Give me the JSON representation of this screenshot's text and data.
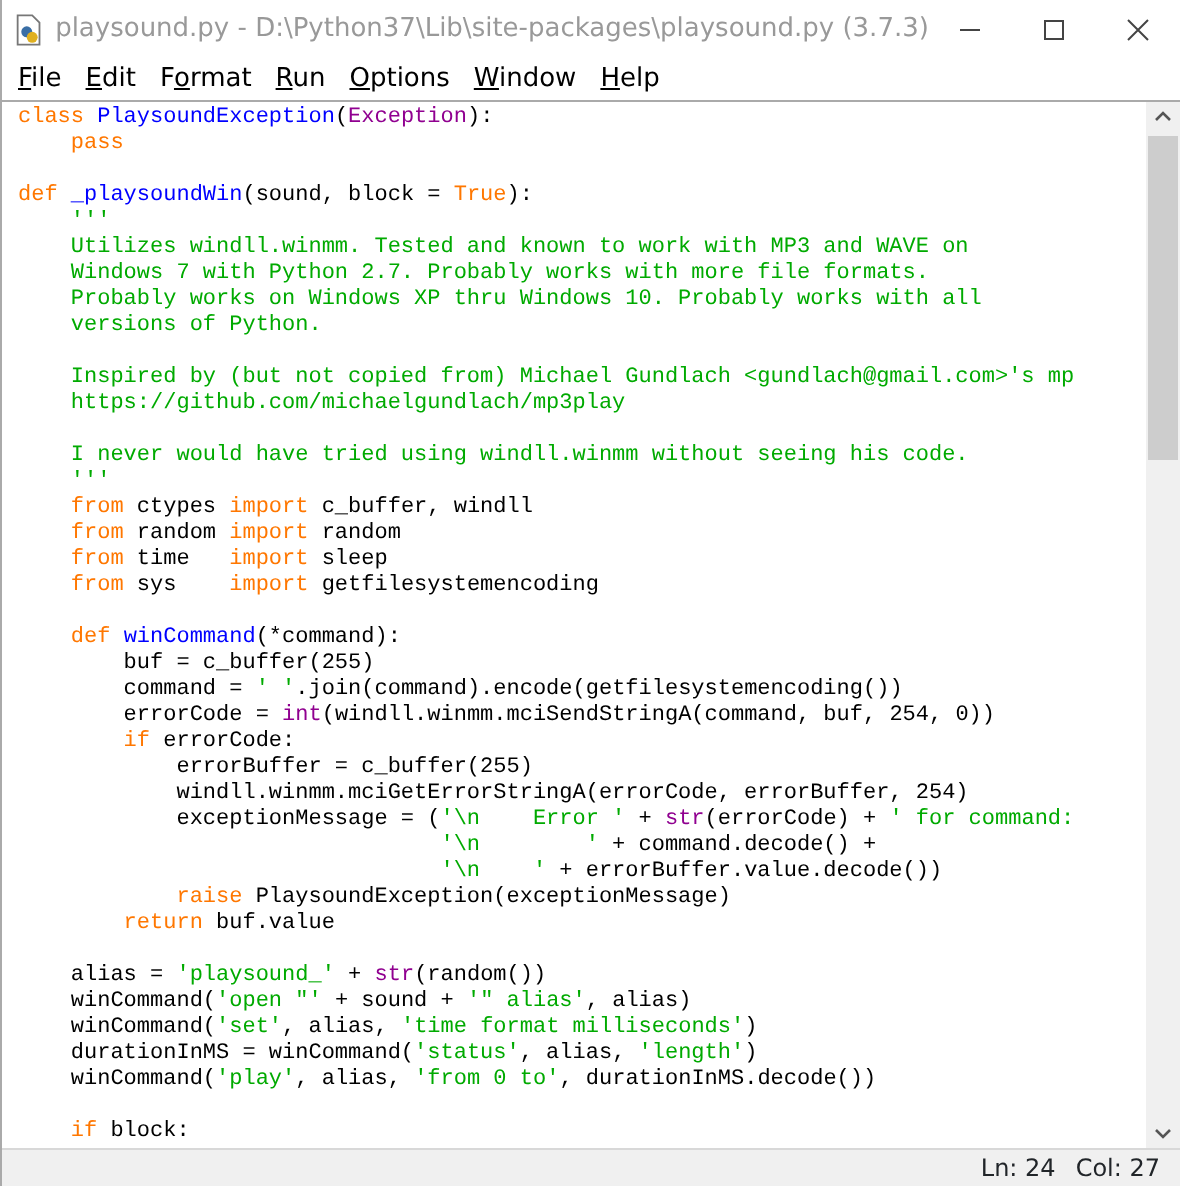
{
  "window": {
    "title": "playsound.py - D:\\Python37\\Lib\\site-packages\\playsound.py (3.7.3)"
  },
  "menu": [
    {
      "access_key": "F",
      "rest": "ile"
    },
    {
      "access_key": "E",
      "rest": "dit"
    },
    {
      "lead": "F",
      "access_key": "o",
      "rest": "rmat"
    },
    {
      "access_key": "R",
      "rest": "un"
    },
    {
      "access_key": "O",
      "rest": "ptions"
    },
    {
      "access_key": "W",
      "rest": "indow"
    },
    {
      "access_key": "H",
      "rest": "elp"
    }
  ],
  "editor": {
    "lines": [
      {
        "kind": "code",
        "tokens": [
          {
            "kind": "keyword",
            "text": "class "
          },
          {
            "kind": "definition",
            "text": "PlaysoundException"
          },
          {
            "kind": "plain",
            "text": "("
          },
          {
            "kind": "builtin",
            "text": "Exception"
          },
          {
            "kind": "plain",
            "text": "):"
          }
        ]
      },
      {
        "kind": "code",
        "tokens": [
          {
            "kind": "keyword",
            "text": "    pass"
          }
        ]
      },
      {
        "kind": "blank"
      },
      {
        "kind": "code",
        "tokens": [
          {
            "kind": "keyword",
            "text": "def "
          },
          {
            "kind": "definition",
            "text": "_playsoundWin"
          },
          {
            "kind": "plain",
            "text": "(sound, block = "
          },
          {
            "kind": "keyword",
            "text": "True"
          },
          {
            "kind": "plain",
            "text": "):"
          }
        ]
      },
      {
        "kind": "code",
        "tokens": [
          {
            "kind": "string",
            "text": "    '''"
          }
        ]
      },
      {
        "kind": "code",
        "tokens": [
          {
            "kind": "string",
            "text": "    Utilizes windll.winmm. Tested and known to work with MP3 and WAVE on"
          }
        ]
      },
      {
        "kind": "code",
        "tokens": [
          {
            "kind": "string",
            "text": "    Windows 7 with Python 2.7. Probably works with more file formats."
          }
        ]
      },
      {
        "kind": "code",
        "tokens": [
          {
            "kind": "string",
            "text": "    Probably works on Windows XP thru Windows 10. Probably works with all"
          }
        ]
      },
      {
        "kind": "code",
        "tokens": [
          {
            "kind": "string",
            "text": "    versions of Python."
          }
        ]
      },
      {
        "kind": "blank"
      },
      {
        "kind": "code",
        "tokens": [
          {
            "kind": "string",
            "text": "    Inspired by (but not copied from) Michael Gundlach <gundlach@gmail.com>'s mp"
          }
        ]
      },
      {
        "kind": "code",
        "tokens": [
          {
            "kind": "string",
            "text": "    https://github.com/michaelgundlach/mp3play"
          }
        ]
      },
      {
        "kind": "blank"
      },
      {
        "kind": "code",
        "tokens": [
          {
            "kind": "string",
            "text": "    I never would have tried using windll.winmm without seeing his code."
          }
        ]
      },
      {
        "kind": "code",
        "tokens": [
          {
            "kind": "string",
            "text": "    '''"
          }
        ]
      },
      {
        "kind": "code",
        "tokens": [
          {
            "kind": "keyword",
            "text": "    from"
          },
          {
            "kind": "plain",
            "text": " ctypes "
          },
          {
            "kind": "keyword",
            "text": "import"
          },
          {
            "kind": "plain",
            "text": " c_buffer, windll"
          }
        ]
      },
      {
        "kind": "code",
        "tokens": [
          {
            "kind": "keyword",
            "text": "    from"
          },
          {
            "kind": "plain",
            "text": " random "
          },
          {
            "kind": "keyword",
            "text": "import"
          },
          {
            "kind": "plain",
            "text": " random"
          }
        ]
      },
      {
        "kind": "code",
        "tokens": [
          {
            "kind": "keyword",
            "text": "    from"
          },
          {
            "kind": "plain",
            "text": " time   "
          },
          {
            "kind": "keyword",
            "text": "import"
          },
          {
            "kind": "plain",
            "text": " sleep"
          }
        ]
      },
      {
        "kind": "code",
        "tokens": [
          {
            "kind": "keyword",
            "text": "    from"
          },
          {
            "kind": "plain",
            "text": " sys    "
          },
          {
            "kind": "keyword",
            "text": "import"
          },
          {
            "kind": "plain",
            "text": " getfilesystemencoding"
          }
        ]
      },
      {
        "kind": "blank"
      },
      {
        "kind": "code",
        "tokens": [
          {
            "kind": "keyword",
            "text": "    def "
          },
          {
            "kind": "definition",
            "text": "winCommand"
          },
          {
            "kind": "plain",
            "text": "(*command):"
          }
        ]
      },
      {
        "kind": "code",
        "tokens": [
          {
            "kind": "plain",
            "text": "        buf = c_buffer(255)"
          }
        ]
      },
      {
        "kind": "code",
        "tokens": [
          {
            "kind": "plain",
            "text": "        command = "
          },
          {
            "kind": "string",
            "text": "' '"
          },
          {
            "kind": "plain",
            "text": ".join(command).encode(getfilesystemencoding())"
          }
        ]
      },
      {
        "kind": "code",
        "tokens": [
          {
            "kind": "plain",
            "text": "        errorCode = "
          },
          {
            "kind": "builtin",
            "text": "int"
          },
          {
            "kind": "plain",
            "text": "(windll.winmm.mciSendStringA(command, buf, 254, 0))"
          }
        ]
      },
      {
        "kind": "code",
        "tokens": [
          {
            "kind": "keyword",
            "text": "        if"
          },
          {
            "kind": "plain",
            "text": " errorCode:"
          }
        ]
      },
      {
        "kind": "code",
        "tokens": [
          {
            "kind": "plain",
            "text": "            errorBuffer = c_buffer(255)"
          }
        ]
      },
      {
        "kind": "code",
        "tokens": [
          {
            "kind": "plain",
            "text": "            windll.winmm.mciGetErrorStringA(errorCode, errorBuffer, 254)"
          }
        ]
      },
      {
        "kind": "code",
        "tokens": [
          {
            "kind": "plain",
            "text": "            exceptionMessage = ("
          },
          {
            "kind": "string",
            "text": "'\\n    Error '"
          },
          {
            "kind": "plain",
            "text": " + "
          },
          {
            "kind": "builtin",
            "text": "str"
          },
          {
            "kind": "plain",
            "text": "(errorCode) + "
          },
          {
            "kind": "string",
            "text": "' for command:"
          }
        ]
      },
      {
        "kind": "code",
        "tokens": [
          {
            "kind": "string",
            "text": "                                '\\n        '"
          },
          {
            "kind": "plain",
            "text": " + command.decode() +"
          }
        ]
      },
      {
        "kind": "code",
        "tokens": [
          {
            "kind": "string",
            "text": "                                '\\n    '"
          },
          {
            "kind": "plain",
            "text": " + errorBuffer.value.decode())"
          }
        ]
      },
      {
        "kind": "code",
        "tokens": [
          {
            "kind": "keyword",
            "text": "            raise"
          },
          {
            "kind": "plain",
            "text": " PlaysoundException(exceptionMessage)"
          }
        ]
      },
      {
        "kind": "code",
        "tokens": [
          {
            "kind": "keyword",
            "text": "        return"
          },
          {
            "kind": "plain",
            "text": " buf.value"
          }
        ]
      },
      {
        "kind": "blank"
      },
      {
        "kind": "code",
        "tokens": [
          {
            "kind": "plain",
            "text": "    alias = "
          },
          {
            "kind": "string",
            "text": "'playsound_'"
          },
          {
            "kind": "plain",
            "text": " + "
          },
          {
            "kind": "builtin",
            "text": "str"
          },
          {
            "kind": "plain",
            "text": "(random())"
          }
        ]
      },
      {
        "kind": "code",
        "tokens": [
          {
            "kind": "plain",
            "text": "    winCommand("
          },
          {
            "kind": "string",
            "text": "'open \"'"
          },
          {
            "kind": "plain",
            "text": " + sound + "
          },
          {
            "kind": "string",
            "text": "'\" alias'"
          },
          {
            "kind": "plain",
            "text": ", alias)"
          }
        ]
      },
      {
        "kind": "code",
        "tokens": [
          {
            "kind": "plain",
            "text": "    winCommand("
          },
          {
            "kind": "string",
            "text": "'set'"
          },
          {
            "kind": "plain",
            "text": ", alias, "
          },
          {
            "kind": "string",
            "text": "'time format milliseconds'"
          },
          {
            "kind": "plain",
            "text": ")"
          }
        ]
      },
      {
        "kind": "code",
        "tokens": [
          {
            "kind": "plain",
            "text": "    durationInMS = winCommand("
          },
          {
            "kind": "string",
            "text": "'status'"
          },
          {
            "kind": "plain",
            "text": ", alias, "
          },
          {
            "kind": "string",
            "text": "'length'"
          },
          {
            "kind": "plain",
            "text": ")"
          }
        ]
      },
      {
        "kind": "code",
        "tokens": [
          {
            "kind": "plain",
            "text": "    winCommand("
          },
          {
            "kind": "string",
            "text": "'play'"
          },
          {
            "kind": "plain",
            "text": ", alias, "
          },
          {
            "kind": "string",
            "text": "'from 0 to'"
          },
          {
            "kind": "plain",
            "text": ", durationInMS.decode())"
          }
        ]
      },
      {
        "kind": "blank"
      },
      {
        "kind": "code",
        "tokens": [
          {
            "kind": "keyword",
            "text": "    if"
          },
          {
            "kind": "plain",
            "text": " block:"
          }
        ]
      }
    ]
  },
  "status_bar": {
    "line": "Ln: 24",
    "column": "Col: 27"
  }
}
